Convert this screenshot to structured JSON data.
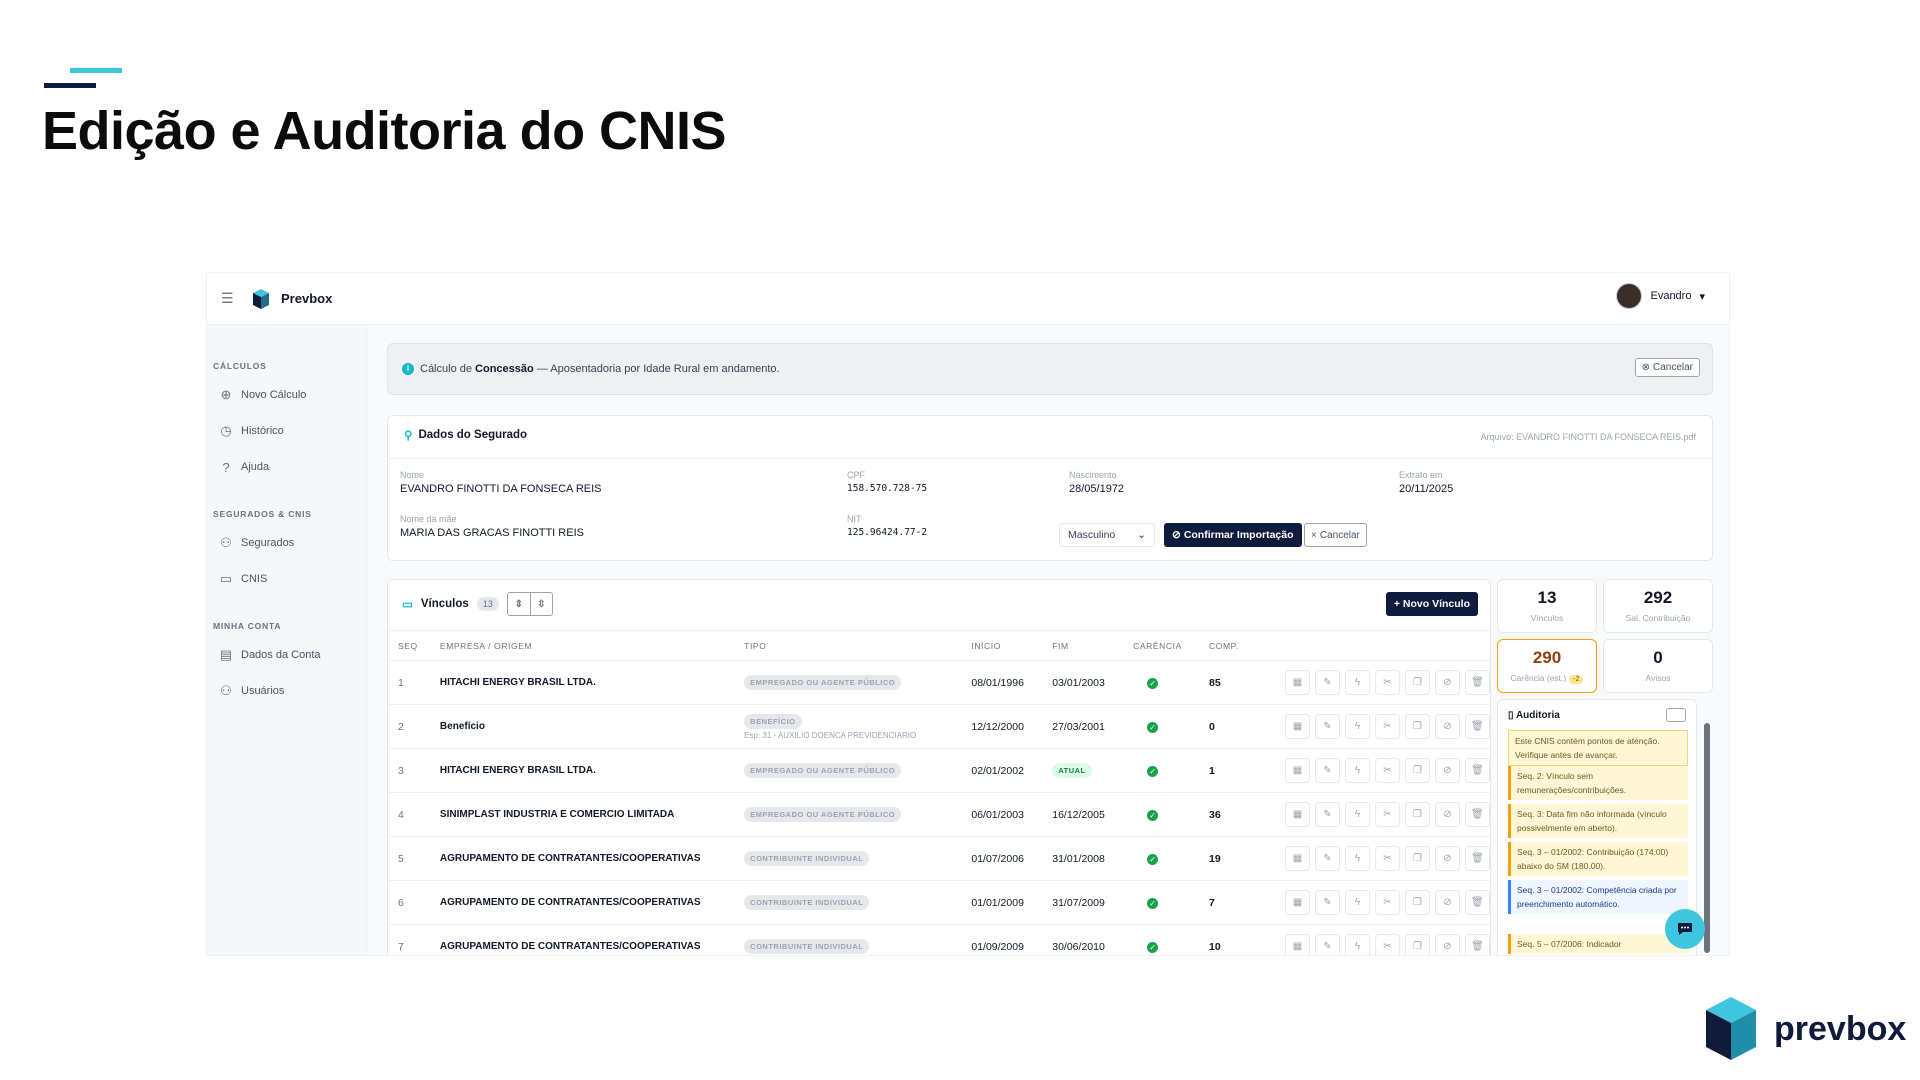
{
  "slide": {
    "title": "Edição e Auditoria do CNIS",
    "brand": "prevbox"
  },
  "app": {
    "name": "Prevbox",
    "user": "Evandro"
  },
  "sidebar": {
    "sections": [
      {
        "title": "CÁLCULOS",
        "items": [
          "Novo Cálculo",
          "Histórico",
          "Ajuda"
        ]
      },
      {
        "title": "SEGURADOS & CNIS",
        "items": [
          "Segurados",
          "CNIS"
        ]
      },
      {
        "title": "MINHA CONTA",
        "items": [
          "Dados da Conta",
          "Usuários"
        ]
      }
    ]
  },
  "alert": {
    "prefix": "Cálculo de ",
    "bold": "Concessão",
    "suffix": " — Aposentadoria por Idade Rural em andamento.",
    "cancel": "Cancelar"
  },
  "segurado": {
    "title": "Dados do Segurado",
    "file": "Arquivo: EVANDRO FINOTTI DA FONSECA REIS.pdf",
    "fields": {
      "nome_label": "Nome",
      "nome": "EVANDRO FINOTTI DA FONSECA REIS",
      "cpf_label": "CPF",
      "cpf": "158.570.728-75",
      "nasc_label": "Nascimento",
      "nasc": "28/05/1972",
      "extrato_label": "Extrato em",
      "extrato": "20/11/2025",
      "mae_label": "Nome da mãe",
      "mae": "MARIA DAS GRACAS FINOTTI REIS",
      "nit_label": "NIT",
      "nit": "125.96424.77-2"
    },
    "sexo": "Masculino",
    "confirm": "Confirmar Importação",
    "cancel": "Cancelar"
  },
  "vinculos": {
    "title": "Vínculos",
    "count": "13",
    "new_button": "Novo Vínculo",
    "headers": [
      "SEQ",
      "EMPRESA / ORIGEM",
      "TIPO",
      "INÍCIO",
      "FIM",
      "CARÊNCIA",
      "COMP."
    ],
    "rows": [
      {
        "seq": "1",
        "empresa": "HITACHI ENERGY BRASIL LTDA.",
        "tipo": "EMPREGADO OU AGENTE PÚBLICO",
        "sub": "",
        "inicio": "08/01/1996",
        "fim": "03/01/2003",
        "comp": "85"
      },
      {
        "seq": "2",
        "empresa": "Benefício",
        "tipo": "BENEFÍCIO",
        "sub": "Esp: 31 - AUXILIO DOENCA PREVIDENCIARIO",
        "inicio": "12/12/2000",
        "fim": "27/03/2001",
        "comp": "0"
      },
      {
        "seq": "3",
        "empresa": "HITACHI ENERGY BRASIL LTDA.",
        "tipo": "EMPREGADO OU AGENTE PÚBLICO",
        "sub": "",
        "inicio": "02/01/2002",
        "fim": "ATUAL",
        "comp": "1"
      },
      {
        "seq": "4",
        "empresa": "SINIMPLAST INDUSTRIA E COMERCIO LIMITADA",
        "tipo": "EMPREGADO OU AGENTE PÚBLICO",
        "sub": "",
        "inicio": "06/01/2003",
        "fim": "16/12/2005",
        "comp": "36"
      },
      {
        "seq": "5",
        "empresa": "AGRUPAMENTO DE CONTRATANTES/COOPERATIVAS",
        "tipo": "CONTRIBUINTE INDIVIDUAL",
        "sub": "",
        "inicio": "01/07/2006",
        "fim": "31/01/2008",
        "comp": "19"
      },
      {
        "seq": "6",
        "empresa": "AGRUPAMENTO DE CONTRATANTES/COOPERATIVAS",
        "tipo": "CONTRIBUINTE INDIVIDUAL",
        "sub": "",
        "inicio": "01/01/2009",
        "fim": "31/07/2009",
        "comp": "7"
      },
      {
        "seq": "7",
        "empresa": "AGRUPAMENTO DE CONTRATANTES/COOPERATIVAS",
        "tipo": "CONTRIBUINTE INDIVIDUAL",
        "sub": "",
        "inicio": "01/09/2009",
        "fim": "30/06/2010",
        "comp": "10"
      }
    ]
  },
  "stats": [
    {
      "n": "13",
      "l": "Vínculos"
    },
    {
      "n": "292",
      "l": "Sal. Contribuição"
    },
    {
      "n": "290",
      "l": "Carência (est.)",
      "pill": "-2"
    },
    {
      "n": "0",
      "l": "Avisos"
    }
  ],
  "auditoria": {
    "title": "Auditoria",
    "items": [
      "Este CNIS contém pontos de atenção. Verifique antes de avançar.",
      "Seq. 2: Vínculo sem remunerações/contribuições.",
      "Seq. 3: Data fim não informada (vínculo possivelmente em aberto).",
      "Seq. 3 – 01/2002: Contribuição (174.00) abaixo do SM (180.00).",
      "Seq. 3 – 01/2002: Competência criada por preenchimento automático.",
      "Seq. 5 – 07/2006: Indicador"
    ]
  }
}
